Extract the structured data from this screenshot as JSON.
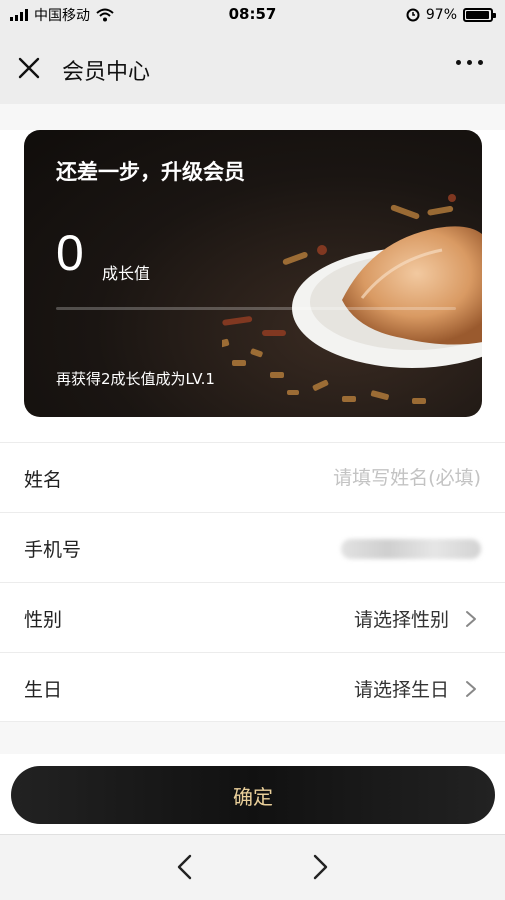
{
  "status_bar": {
    "carrier": "中国移动",
    "time": "08:57",
    "battery": "97%",
    "battery_level": 0.97,
    "icons": [
      "signal-icon",
      "wifi-icon",
      "alarm-icon",
      "battery-icon"
    ]
  },
  "nav": {
    "title": "会员中心",
    "close_icon": "close-icon",
    "more_icon": "more-icon"
  },
  "card": {
    "title": "还差一步，升级会员",
    "growth_value": "0",
    "growth_label": "成长值",
    "progress": 0,
    "hint": "再获得2成长值成为LV.1"
  },
  "form": {
    "name": {
      "label": "姓名",
      "placeholder": "请填写姓名(必填)",
      "value": ""
    },
    "phone": {
      "label": "手机号"
    },
    "gender": {
      "label": "性别",
      "value": "请选择性别"
    },
    "birthday": {
      "label": "生日",
      "value": "请选择生日"
    }
  },
  "confirm_label": "确定",
  "toolbar": {
    "back_icon": "chevron-left-icon",
    "forward_icon": "chevron-right-icon"
  },
  "colors": {
    "card_bg": "#1a1512",
    "button_bg": "#1a1a1a",
    "button_text": "#e9cf9a",
    "placeholder": "#c3c3c3"
  }
}
